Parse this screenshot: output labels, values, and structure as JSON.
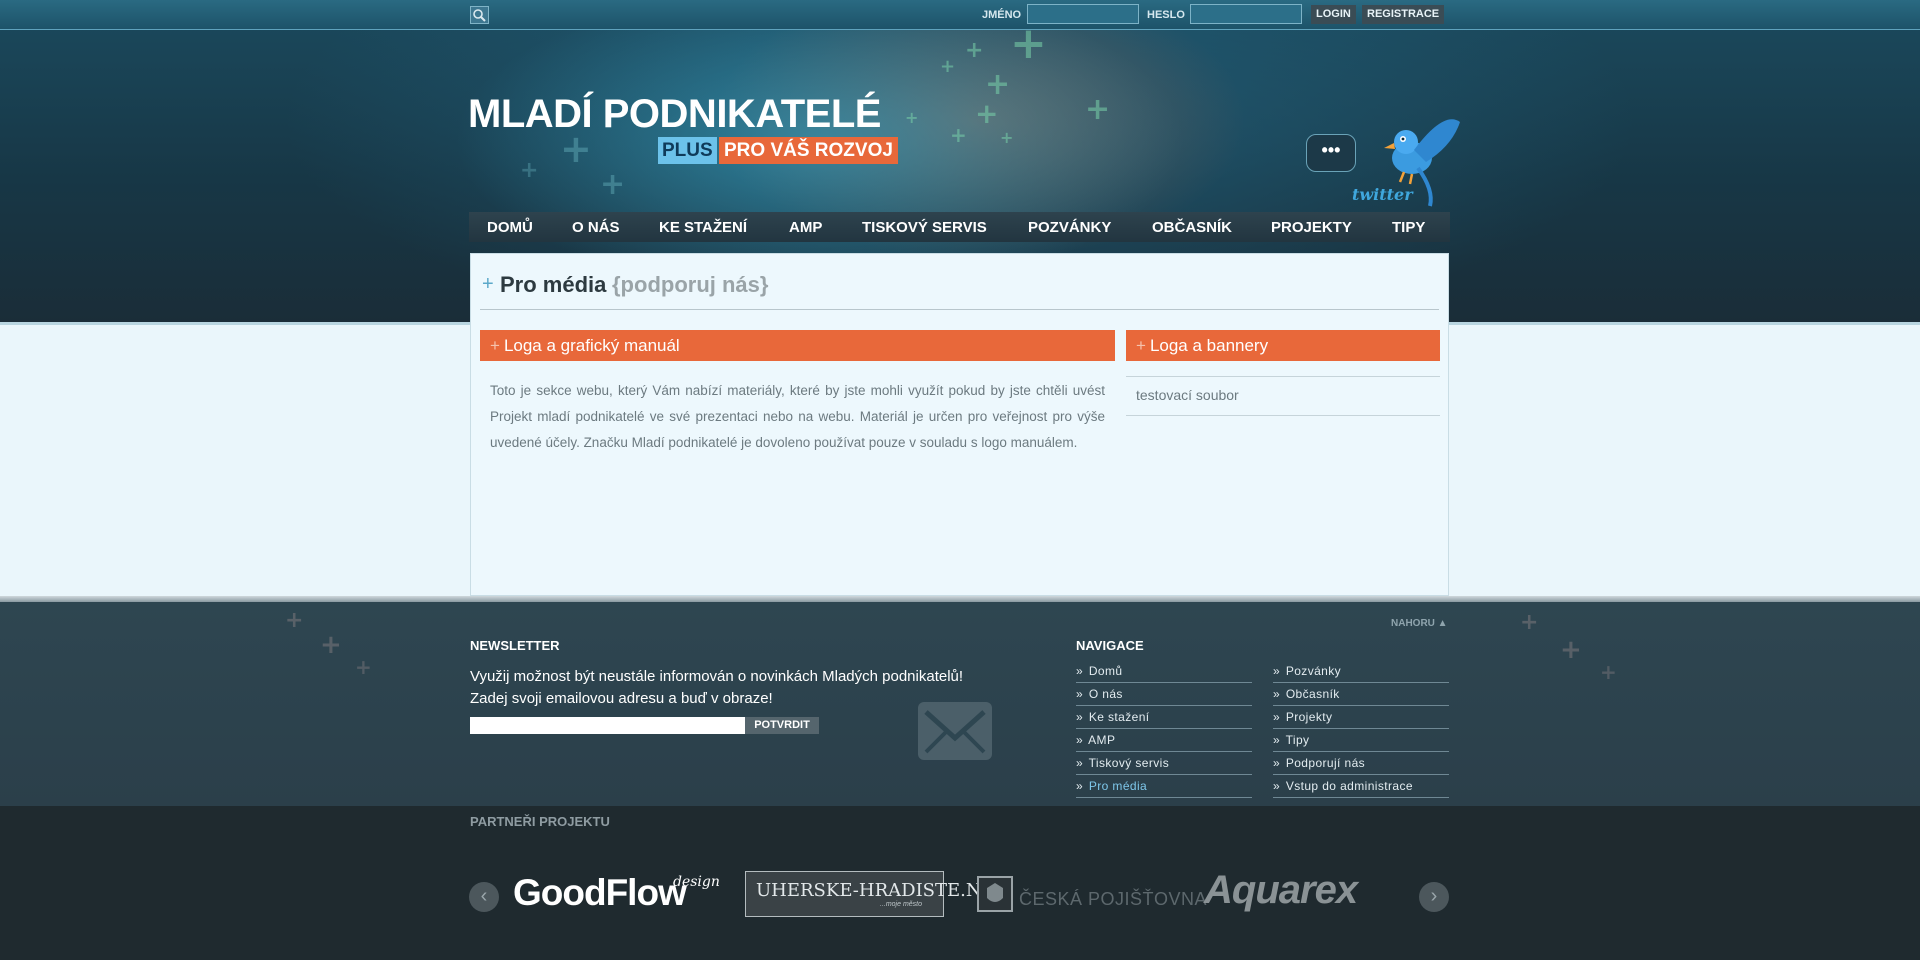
{
  "header": {
    "login": {
      "name_label": "JMÉNO",
      "password_label": "HESLO",
      "name_value": "",
      "password_value": "",
      "login_button": "LOGIN",
      "register_button": "REGISTRACE"
    },
    "logo": {
      "title": "MLADÍ PODNIKATELÉ",
      "plus": "PLUS",
      "tagline": "PRO VÁŠ ROZVOJ"
    },
    "twitter": {
      "bubble": "•••",
      "word": "twitter"
    }
  },
  "nav": {
    "items": [
      "DOMŮ",
      "O NÁS",
      "KE STAŽENÍ",
      "AMP",
      "TISKOVÝ SERVIS",
      "POZVÁNKY",
      "OBČASNÍK",
      "PROJEKTY",
      "TIPY"
    ]
  },
  "main": {
    "title_plus": "+",
    "title": "Pro média",
    "subtitle": "{podporuj nás}",
    "left_section": {
      "plus": "+",
      "heading": "Loga a grafický manuál",
      "body": "Toto je sekce webu, který Vám nabízí materiály, které by jste mohli využít pokud by jste chtěli uvést Projekt mladí podnikatelé ve své prezentaci nebo na webu. Materiál je určen pro veřejnost pro výše uvedené účely. Značku Mladí podnikatelé je dovoleno používat pouze v souladu s logo manuálem."
    },
    "right_section": {
      "plus": "+",
      "heading": "Loga a bannery",
      "files": [
        "testovací soubor"
      ]
    }
  },
  "footer": {
    "back_to_top": "NAHORU ▲",
    "newsletter": {
      "heading": "NEWSLETTER",
      "line1": "Využij možnost být neustále informován o novinkách Mladých podnikatelů!",
      "line2": "Zadej svoji emailovou adresu a buď v obraze!",
      "input_value": "",
      "submit": "POTVRDIT"
    },
    "navigation": {
      "heading": "NAVIGACE",
      "col1": [
        "Domů",
        "O nás",
        "Ke stažení",
        "AMP",
        "Tiskový servis",
        "Pro média"
      ],
      "col2": [
        "Pozvánky",
        "Občasník",
        "Projekty",
        "Tipy",
        "Podporují nás",
        "Vstup do administrace"
      ],
      "active": "Pro média",
      "prefix": "»"
    },
    "partners": {
      "heading": "PARTNEŘI PROJEKTU",
      "prev": "‹",
      "next": "›",
      "logos": {
        "goodflow": "GoodFlow",
        "goodflow_sub": "design",
        "uh": "UHERSKE-HRADISTE.NET",
        "uh_sub": "...moje město",
        "cp": "ČESKÁ POJIŠŤOVNA",
        "aquarex": "Aquarex"
      }
    }
  },
  "colors": {
    "accent_orange": "#e8683a",
    "accent_blue": "#6cc2ea",
    "header_dark": "#173746",
    "content_bg": "#eaf6fb"
  },
  "icons": {
    "search": "search-icon",
    "twitter_bird": "twitter-bird-icon",
    "envelope": "envelope-icon",
    "prev": "chevron-left-icon",
    "next": "chevron-right-icon"
  }
}
